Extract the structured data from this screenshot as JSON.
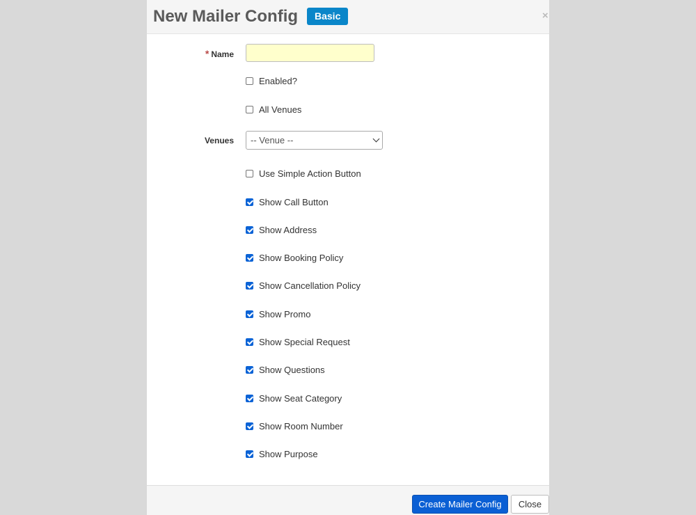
{
  "header": {
    "title": "New Mailer Config",
    "badge": "Basic",
    "close_label": "×"
  },
  "form": {
    "name_label": "Name",
    "required_mark": "*",
    "name_value": "",
    "venues_label": "Venues",
    "venues_selected": "-- Venue --",
    "checkboxes": [
      {
        "label": "Enabled?",
        "checked": false
      },
      {
        "label": "All Venues",
        "checked": false
      },
      {
        "label": "Use Simple Action Button",
        "checked": false
      },
      {
        "label": "Show Call Button",
        "checked": true
      },
      {
        "label": "Show Address",
        "checked": true
      },
      {
        "label": "Show Booking Policy",
        "checked": true
      },
      {
        "label": "Show Cancellation Policy",
        "checked": true
      },
      {
        "label": "Show Promo",
        "checked": true
      },
      {
        "label": "Show Special Request",
        "checked": true
      },
      {
        "label": "Show Questions",
        "checked": true
      },
      {
        "label": "Show Seat Category",
        "checked": true
      },
      {
        "label": "Show Room Number",
        "checked": true
      },
      {
        "label": "Show Purpose",
        "checked": true
      }
    ]
  },
  "footer": {
    "create_label": "Create Mailer Config",
    "close_label": "Close"
  },
  "colors": {
    "badge": "#0a86c9",
    "primary_button": "#0a5fd4",
    "checkbox_checked": "#0b63d6",
    "name_input_bg": "#ffffcc",
    "required": "#b94a48"
  }
}
